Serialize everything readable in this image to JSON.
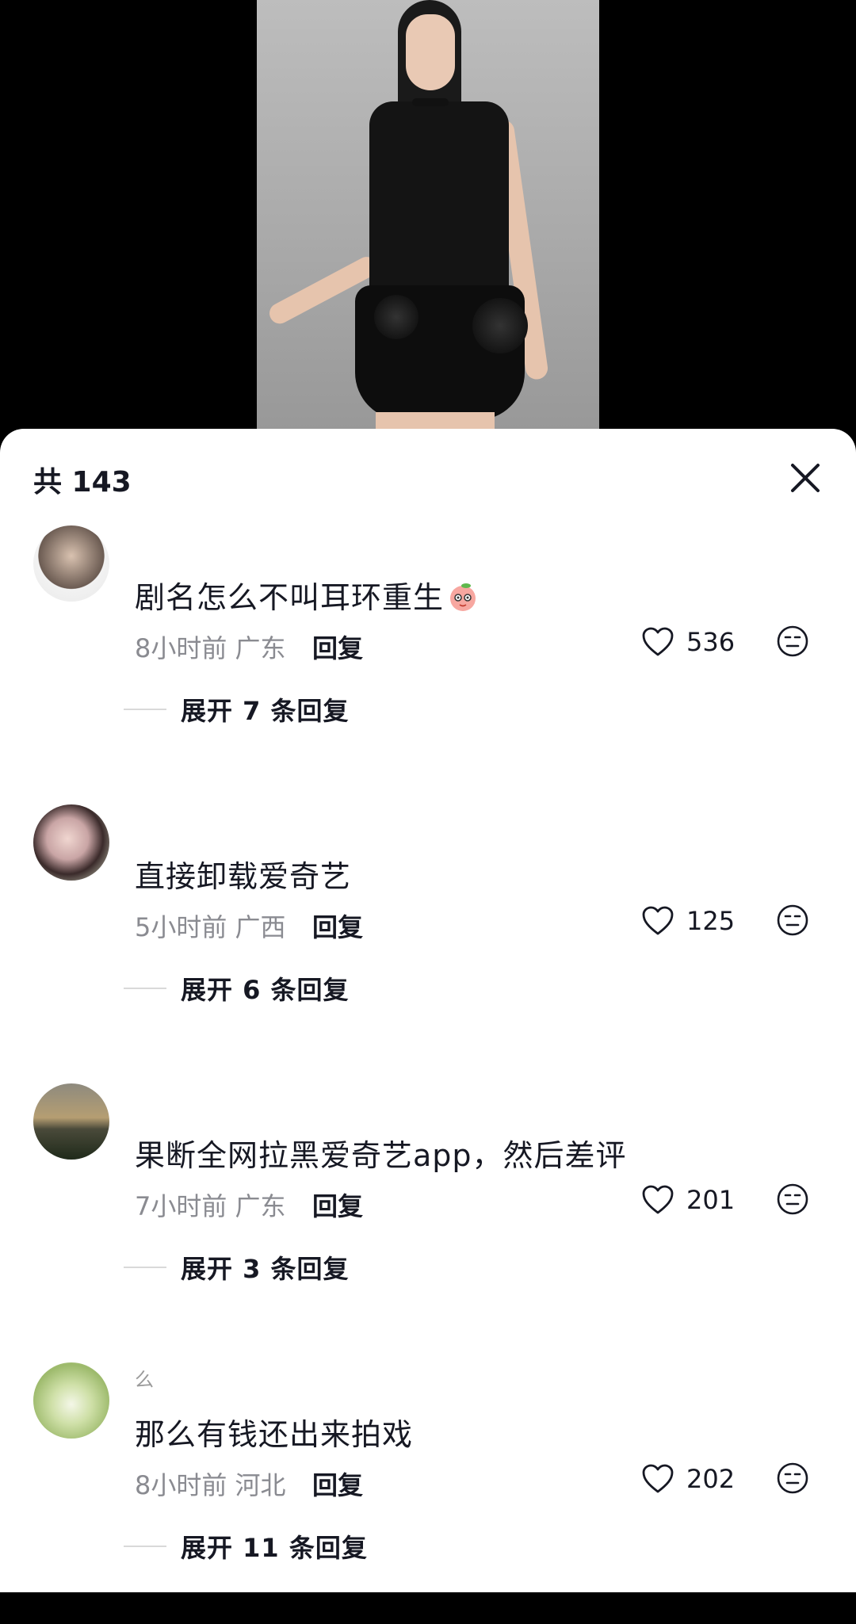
{
  "header": {
    "comment_count": "共 143"
  },
  "comments": [
    {
      "username": "",
      "text": "剧名怎么不叫耳环重生",
      "emoji": "peach-face",
      "time": "8小时前",
      "location": "广东",
      "reply_label": "回复",
      "likes": "536",
      "expand_label": "展开 7 条回复"
    },
    {
      "username": "",
      "text": "直接卸载爱奇艺",
      "time": "5小时前",
      "location": "广西",
      "reply_label": "回复",
      "likes": "125",
      "expand_label": "展开 6 条回复"
    },
    {
      "username": "",
      "text": "果断全网拉黑爱奇艺app，然后差评",
      "time": "7小时前",
      "location": "广东",
      "reply_label": "回复",
      "likes": "201",
      "expand_label": "展开 3 条回复"
    },
    {
      "username": "么",
      "text": "那么有钱还出来拍戏",
      "time": "8小时前",
      "location": "河北",
      "reply_label": "回复",
      "likes": "202",
      "expand_label": "展开 11 条回复"
    }
  ],
  "icons": {
    "close": "close-icon",
    "like": "heart-outline-icon",
    "dislike": "meh-face-icon"
  },
  "colors": {
    "text_primary": "#161823",
    "text_secondary": "#8a8b91",
    "sheet_bg": "#ffffff",
    "video_bg": "#000000"
  }
}
